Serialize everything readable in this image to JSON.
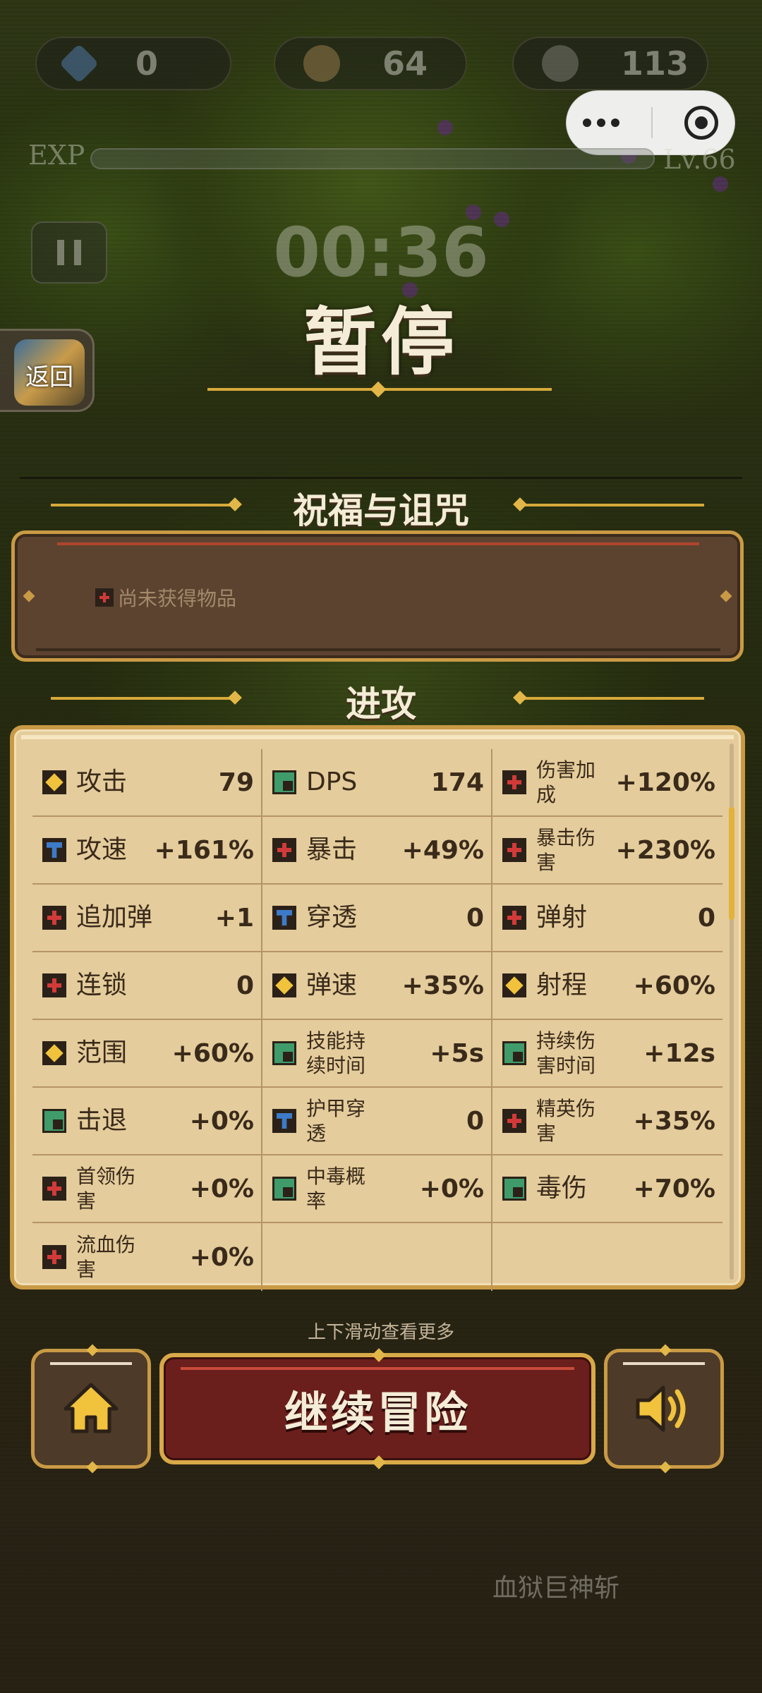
{
  "hud": {
    "gems": "0",
    "coins": "64",
    "kills": "113",
    "exp_label": "EXP",
    "level": "Lv.66",
    "timer": "00:36"
  },
  "back_button": {
    "label": "返回"
  },
  "pause": {
    "title": "暂停"
  },
  "blessings": {
    "heading": "祝福与诅咒",
    "empty_text": "尚未获得物品"
  },
  "attack": {
    "heading": "进攻",
    "stats": [
      {
        "icon": "diamond",
        "label": "攻击",
        "value": "79"
      },
      {
        "icon": "square",
        "label": "DPS",
        "value": "174"
      },
      {
        "icon": "cross",
        "label": "伤害加成",
        "value": "+120%",
        "small": true
      },
      {
        "icon": "tee",
        "label": "攻速",
        "value": "+161%"
      },
      {
        "icon": "cross",
        "label": "暴击",
        "value": "+49%"
      },
      {
        "icon": "cross",
        "label": "暴击伤害",
        "value": "+230%",
        "small": true
      },
      {
        "icon": "cross",
        "label": "追加弹",
        "value": "+1"
      },
      {
        "icon": "tee",
        "label": "穿透",
        "value": "0"
      },
      {
        "icon": "cross",
        "label": "弹射",
        "value": "0"
      },
      {
        "icon": "cross",
        "label": "连锁",
        "value": "0"
      },
      {
        "icon": "diamond",
        "label": "弹速",
        "value": "+35%"
      },
      {
        "icon": "diamond",
        "label": "射程",
        "value": "+60%"
      },
      {
        "icon": "diamond",
        "label": "范围",
        "value": "+60%"
      },
      {
        "icon": "square",
        "label": "技能持续时间",
        "value": "+5s",
        "small": true
      },
      {
        "icon": "square",
        "label": "持续伤害时间",
        "value": "+12s",
        "small": true
      },
      {
        "icon": "square",
        "label": "击退",
        "value": "+0%"
      },
      {
        "icon": "tee",
        "label": "护甲穿透",
        "value": "0",
        "small": true
      },
      {
        "icon": "cross",
        "label": "精英伤害",
        "value": "+35%",
        "small": true
      },
      {
        "icon": "cross",
        "label": "首领伤害",
        "value": "+0%",
        "small": true
      },
      {
        "icon": "square",
        "label": "中毒概率",
        "value": "+0%",
        "small": true
      },
      {
        "icon": "square",
        "label": "毒伤",
        "value": "+70%"
      },
      {
        "icon": "cross",
        "label": "流血伤害",
        "value": "+0%",
        "small": true
      }
    ]
  },
  "scroll_hint": "上下滑动查看更多",
  "buttons": {
    "continue": "继续冒险",
    "home_icon": "home-icon",
    "sound_icon": "speaker-icon"
  },
  "background": {
    "skill_name": "血狱巨神斩"
  }
}
